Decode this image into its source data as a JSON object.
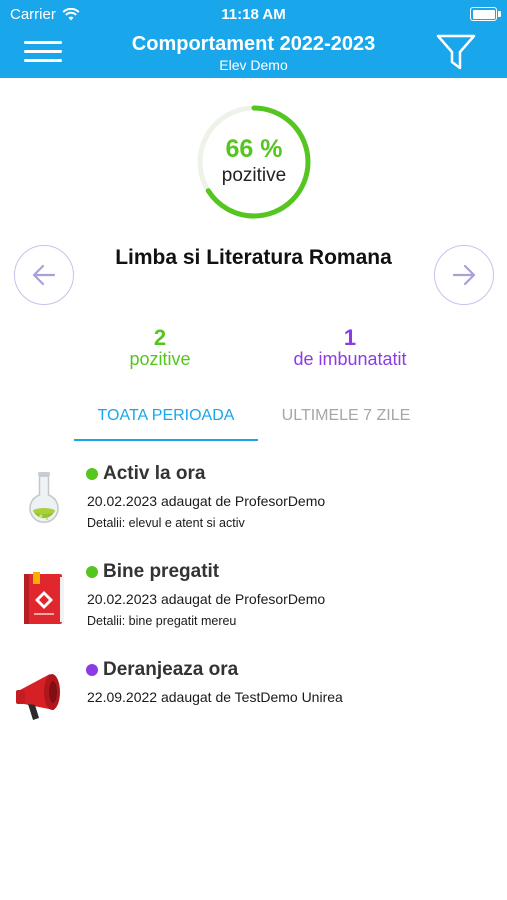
{
  "status_bar": {
    "carrier": "Carrier",
    "time": "11:18 AM"
  },
  "header": {
    "title": "Comportament 2022-2023",
    "subtitle": "Elev Demo"
  },
  "summary": {
    "percent_text": "66 %",
    "percent_value": 66,
    "percent_label": "pozitive",
    "color": "#55c51f"
  },
  "subject": {
    "name": "Limba si Literatura Romana"
  },
  "stats": {
    "positive": {
      "count": "2",
      "label": "pozitive",
      "color": "#55c51f"
    },
    "improve": {
      "count": "1",
      "label": "de imbunatatit",
      "color": "#8c3be4"
    }
  },
  "tabs": [
    {
      "label": "TOATA PERIOADA",
      "active": true
    },
    {
      "label": "ULTIMELE 7 ZILE",
      "active": false
    }
  ],
  "items": [
    {
      "title": "Activ la ora",
      "dot_color": "#55c51f",
      "meta": "20.02.2023 adaugat de ProfesorDemo",
      "detail": "Detalii: elevul e atent si activ",
      "icon": "flask-icon"
    },
    {
      "title": "Bine pregatit",
      "dot_color": "#55c51f",
      "meta": "20.02.2023 adaugat de ProfesorDemo",
      "detail": "Detalii: bine pregatit mereu",
      "icon": "book-icon"
    },
    {
      "title": "Deranjeaza ora",
      "dot_color": "#8c3be4",
      "meta": "22.09.2022 adaugat de TestDemo Unirea",
      "detail": "",
      "icon": "megaphone-icon"
    }
  ],
  "colors": {
    "accent": "#1aa6ea",
    "positive": "#55c51f",
    "negative": "#8c3be4"
  }
}
